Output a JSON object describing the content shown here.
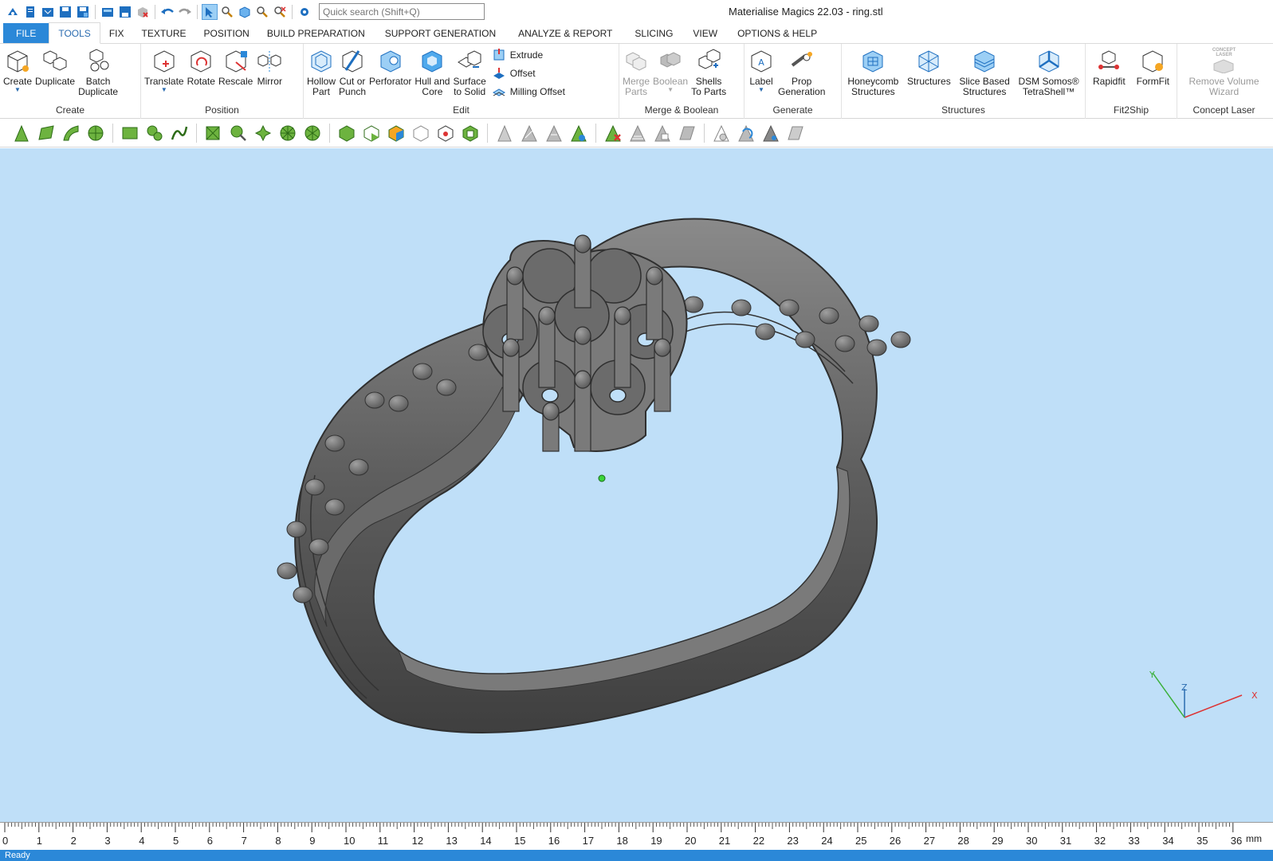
{
  "window": {
    "title": "Materialise Magics 22.03 - ring.stl"
  },
  "search": {
    "placeholder": "Quick search (Shift+Q)"
  },
  "tabs": [
    "FILE",
    "TOOLS",
    "FIX",
    "TEXTURE",
    "POSITION",
    "BUILD PREPARATION",
    "SUPPORT GENERATION",
    "ANALYZE & REPORT",
    "SLICING",
    "VIEW",
    "OPTIONS & HELP"
  ],
  "active_tab": "TOOLS",
  "ribbon": {
    "create": {
      "label": "Create",
      "buttons": [
        "Create",
        "Duplicate",
        "Batch\nDuplicate"
      ]
    },
    "position": {
      "label": "Position",
      "buttons": [
        "Translate",
        "Rotate",
        "Rescale",
        "Mirror"
      ]
    },
    "edit": {
      "label": "Edit",
      "buttons": [
        "Hollow\nPart",
        "Cut or\nPunch",
        "Perforator",
        "Hull and\nCore",
        "Surface\nto Solid"
      ],
      "stack": [
        "Extrude",
        "Offset",
        "Milling Offset"
      ]
    },
    "merge": {
      "label": "Merge & Boolean",
      "buttons": [
        "Merge\nParts",
        "Boolean",
        "Shells\nTo Parts"
      ]
    },
    "generate": {
      "label": "Generate",
      "buttons": [
        "Label",
        "Prop\nGeneration"
      ]
    },
    "structures": {
      "label": "Structures",
      "buttons": [
        "Honeycomb\nStructures",
        "Structures",
        "Slice Based\nStructures",
        "DSM Somos®\nTetraShell™"
      ]
    },
    "fit2ship": {
      "label": "Fit2Ship",
      "buttons": [
        "Rapidfit",
        "FormFit"
      ]
    },
    "concept": {
      "label": "Concept Laser",
      "buttons": [
        "Remove Volume\nWizard"
      ],
      "icon_caption": "CONCEPT\nLASER"
    }
  },
  "axes": {
    "x": "X",
    "y": "Y",
    "z": "Z"
  },
  "ruler": {
    "unit": "mm",
    "ticks": [
      "0",
      "1",
      "2",
      "3",
      "4",
      "5",
      "6",
      "7",
      "8",
      "9",
      "10",
      "11",
      "12",
      "13",
      "14",
      "15",
      "16",
      "17",
      "18",
      "19",
      "20",
      "21",
      "22",
      "23",
      "24",
      "25",
      "26",
      "27",
      "28",
      "29",
      "30",
      "31",
      "32",
      "33",
      "34",
      "35",
      "36"
    ]
  },
  "status": {
    "text": "Ready"
  },
  "colors": {
    "accent": "#2b88d8",
    "viewport": "#bfdff8",
    "model": "#6e6e6e"
  }
}
